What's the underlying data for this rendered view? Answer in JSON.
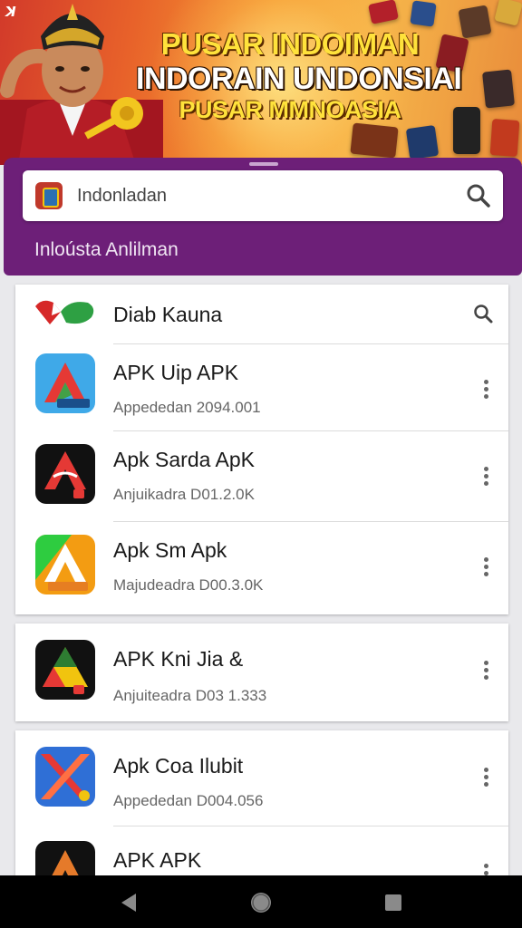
{
  "banner": {
    "line1": "PUSAR INDOIMAN",
    "line2": "INDORAIN UNDONSIAI",
    "line3": "PUSAR MMNOASIA"
  },
  "search": {
    "query": "Indonladan",
    "subtitle": "Inloústa Anlilman"
  },
  "list_header": {
    "title": "Diab Kauna"
  },
  "apps_group1": [
    {
      "name": "APK Uip APK",
      "meta": "Appededan 2094.001",
      "icon": "app-icon-blue"
    },
    {
      "name": "Apk Sarda ApK",
      "meta": "Anjuikadra D01.2.0K",
      "icon": "app-icon-black-red"
    },
    {
      "name": "Apk Sm Apk",
      "meta": "Majudeadra D00.3.0K",
      "icon": "app-icon-green-orange"
    }
  ],
  "apps_group2": [
    {
      "name": "APK Kni Jia &",
      "meta": "Anjuiteadra D03 1.333",
      "icon": "app-icon-black-green"
    }
  ],
  "apps_group3": [
    {
      "name": "Apk Coa Ilubit",
      "meta": "Appededan D004.056",
      "icon": "app-icon-blue-x"
    },
    {
      "name": "APK APK",
      "meta": "",
      "icon": "app-icon-black-orange"
    }
  ],
  "colors": {
    "sheet": "#6d1f78",
    "banner_text": "#ffe23b"
  }
}
